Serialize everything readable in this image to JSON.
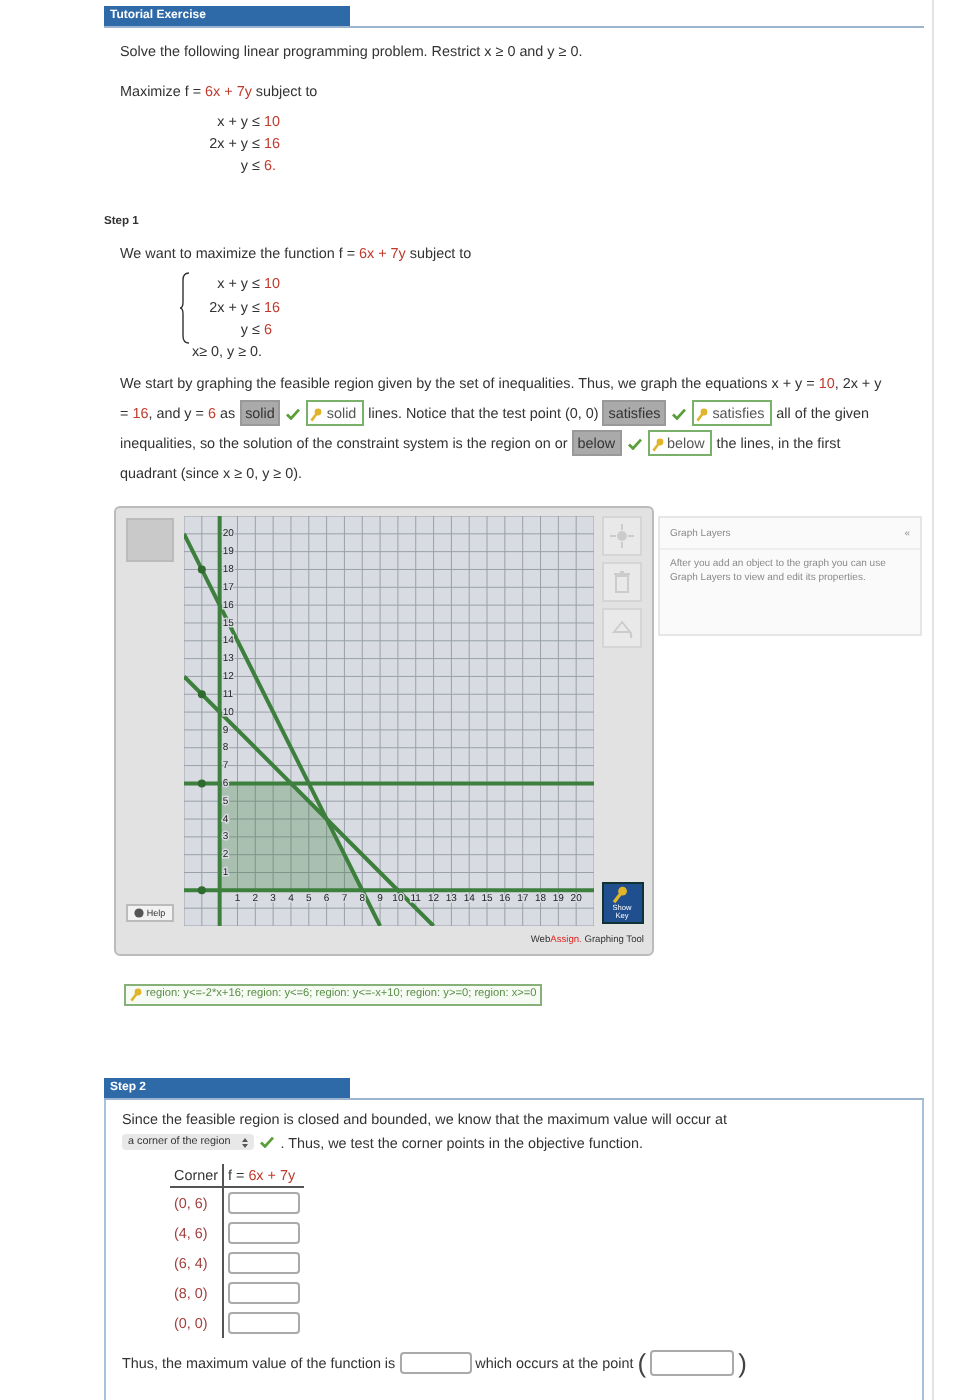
{
  "header": "Tutorial Exercise",
  "problem": {
    "intro": "Solve the following linear programming problem. Restrict x ≥ 0 and y ≥ 0.",
    "objective": {
      "lead": "Maximize",
      "lhs": "f =",
      "rhs": "6x + 7y",
      "tail": "subject to"
    },
    "constraints": [
      {
        "lhs": "x + y",
        "op": "≤",
        "rhs": "10"
      },
      {
        "lhs": "2x + y",
        "op": "≤",
        "rhs": "16"
      },
      {
        "lhs": "y",
        "op": "≤",
        "rhs": "6."
      }
    ]
  },
  "step1": {
    "title": "Step 1",
    "objective": {
      "lead": "We want to maximize the function",
      "lhs": "f =",
      "rhs": "6x + 7y",
      "tail": "subject to"
    },
    "system": [
      {
        "lhs": "x + y",
        "op": "≤",
        "rhs": "10"
      },
      {
        "lhs": "2x + y",
        "op": "≤",
        "rhs": "16"
      },
      {
        "lhs": "y",
        "op": "≤",
        "rhs": "6"
      },
      {
        "lhs": "x≥ 0, y ≥ 0."
      }
    ],
    "paragraph": [
      {
        "kind": "text",
        "text": "We start by graphing the feasible region given by the set of inequalities. Thus, we graph the equations x + y = "
      },
      {
        "kind": "num",
        "text": "10"
      },
      {
        "kind": "text",
        "text": ", 2x + y = "
      },
      {
        "kind": "num",
        "text": "16"
      },
      {
        "kind": "text",
        "text": ", and y = "
      },
      {
        "kind": "num",
        "text": "6"
      },
      {
        "kind": "text",
        "text": " as "
      },
      {
        "kind": "choice",
        "selected": "solid",
        "correct": true,
        "key": "solid"
      },
      {
        "kind": "text",
        "text": " lines. Notice that the test point (0, 0) "
      },
      {
        "kind": "choice",
        "selected": "satisfies",
        "correct": true,
        "key": "satisfies"
      },
      {
        "kind": "text",
        "text": " all of the given inequalities, so the solution of the constraint system is the region on or "
      },
      {
        "kind": "choice",
        "selected": "below",
        "correct": true,
        "key": "below"
      },
      {
        "kind": "text",
        "text": " the lines, in the first quadrant (since x ≥ 0, y ≥ 0)."
      }
    ],
    "graph": {
      "tools": [
        {
          "selected": true
        }
      ],
      "help": "Help",
      "right_tools": [
        {
          "kind": "point",
          "disabled": true
        },
        {
          "kind": "delete",
          "disabled": true
        },
        {
          "kind": "fill",
          "disabled": true
        }
      ],
      "show_key": "Show Key",
      "brand": {
        "first": "Web",
        "second": "Assign.",
        "rest": "Graphing Tool"
      },
      "chart_data": {
        "type": "line",
        "x": [
          -2,
          9,
          12,
          21
        ],
        "xlim": [
          -2,
          21
        ],
        "ylim": [
          -2,
          21
        ],
        "grid": true,
        "xticks": [
          1,
          2,
          3,
          4,
          5,
          6,
          7,
          8,
          9,
          10,
          11,
          12,
          13,
          14,
          15,
          16,
          17,
          18,
          19,
          20
        ],
        "yticks": [
          1,
          2,
          3,
          4,
          5,
          6,
          7,
          8,
          9,
          10,
          11,
          12,
          13,
          14,
          15,
          16,
          17,
          18,
          19,
          20
        ],
        "series": [
          {
            "color": "#3d7f3d",
            "values": [
              20,
              -2,
              null,
              null
            ]
          },
          {
            "color": "#3d7f3d",
            "values": [
              12,
              1,
              -2,
              null
            ]
          },
          {
            "color": "#3d7f3d",
            "values": [
              6,
              6,
              6,
              6
            ]
          },
          {
            "color": "#3d7f3d",
            "values": [
              0,
              0,
              0,
              0
            ]
          }
        ],
        "ref_lines": [
          {
            "axis": "x",
            "value": 0
          }
        ]
      },
      "layers": {
        "title": "Graph Layers",
        "close": "«",
        "text": "After you add an object to the graph you can use Graph Layers to view and edit its properties."
      }
    },
    "answer": "region: y<=-2*x+16; region: y<=6; region: y<=-x+10; region: y>=0; region: x>=0"
  },
  "step2": {
    "title": "Step 2",
    "text_before": "Since the feasible region is closed and bounded, we know that the maximum value will occur at",
    "choice": {
      "selected": "a corner of the region",
      "correct": true
    },
    "text_after": ". Thus, we test the corner points in the objective function.",
    "table": {
      "corner": "Corner",
      "lhs": "f =",
      "rhs": "6x + 7y",
      "rows": [
        "(0, 6)",
        "(4, 6)",
        "(6, 4)",
        "(8, 0)",
        "(0, 0)"
      ]
    },
    "final": {
      "before": "Thus, the maximum value of the function is",
      "middle": "which occurs at the point",
      "open": "(",
      "close": ")"
    }
  }
}
